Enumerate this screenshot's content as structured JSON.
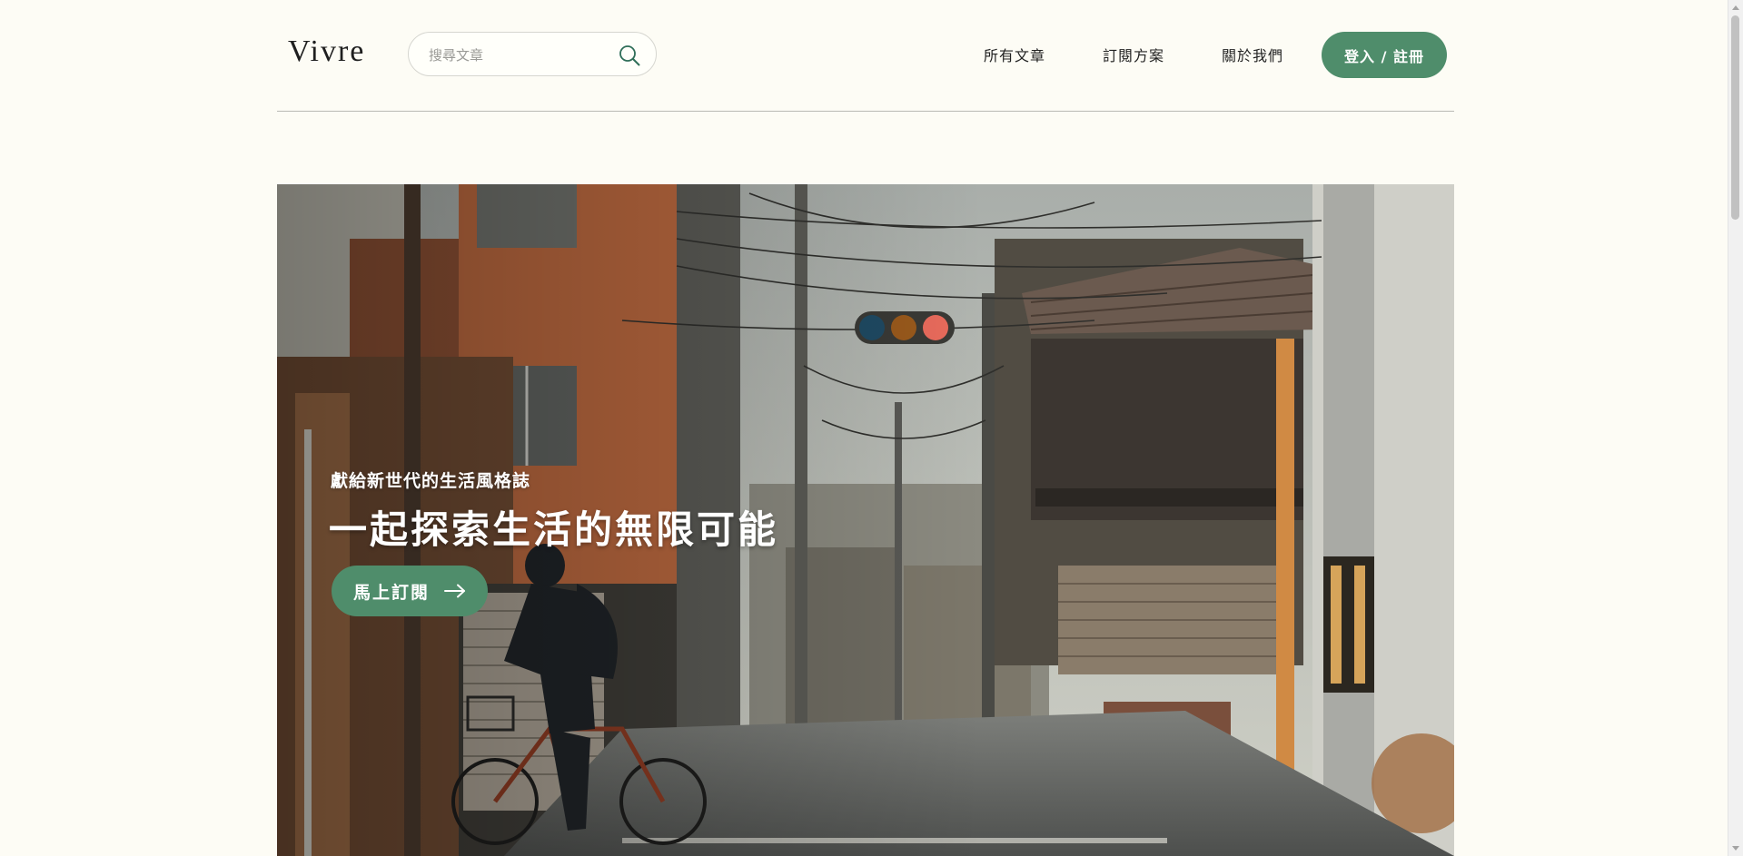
{
  "header": {
    "logo": "Vivre",
    "search": {
      "placeholder": "搜尋文章",
      "value": ""
    },
    "nav": {
      "all_articles": "所有文章",
      "subscription": "訂閱方案",
      "about": "關於我們"
    },
    "login_label": "登入 / 註冊"
  },
  "hero": {
    "subtitle": "獻給新世代的生活風格誌",
    "title": "一起探索生活的無限可能",
    "cta_label": "馬上訂閱"
  },
  "colors": {
    "accent": "#4f8d6b",
    "background": "#fdfcf5",
    "divider": "#b9b9b4"
  },
  "icons": {
    "search": "search-icon",
    "cta_arrow": "arrow-right-icon"
  }
}
